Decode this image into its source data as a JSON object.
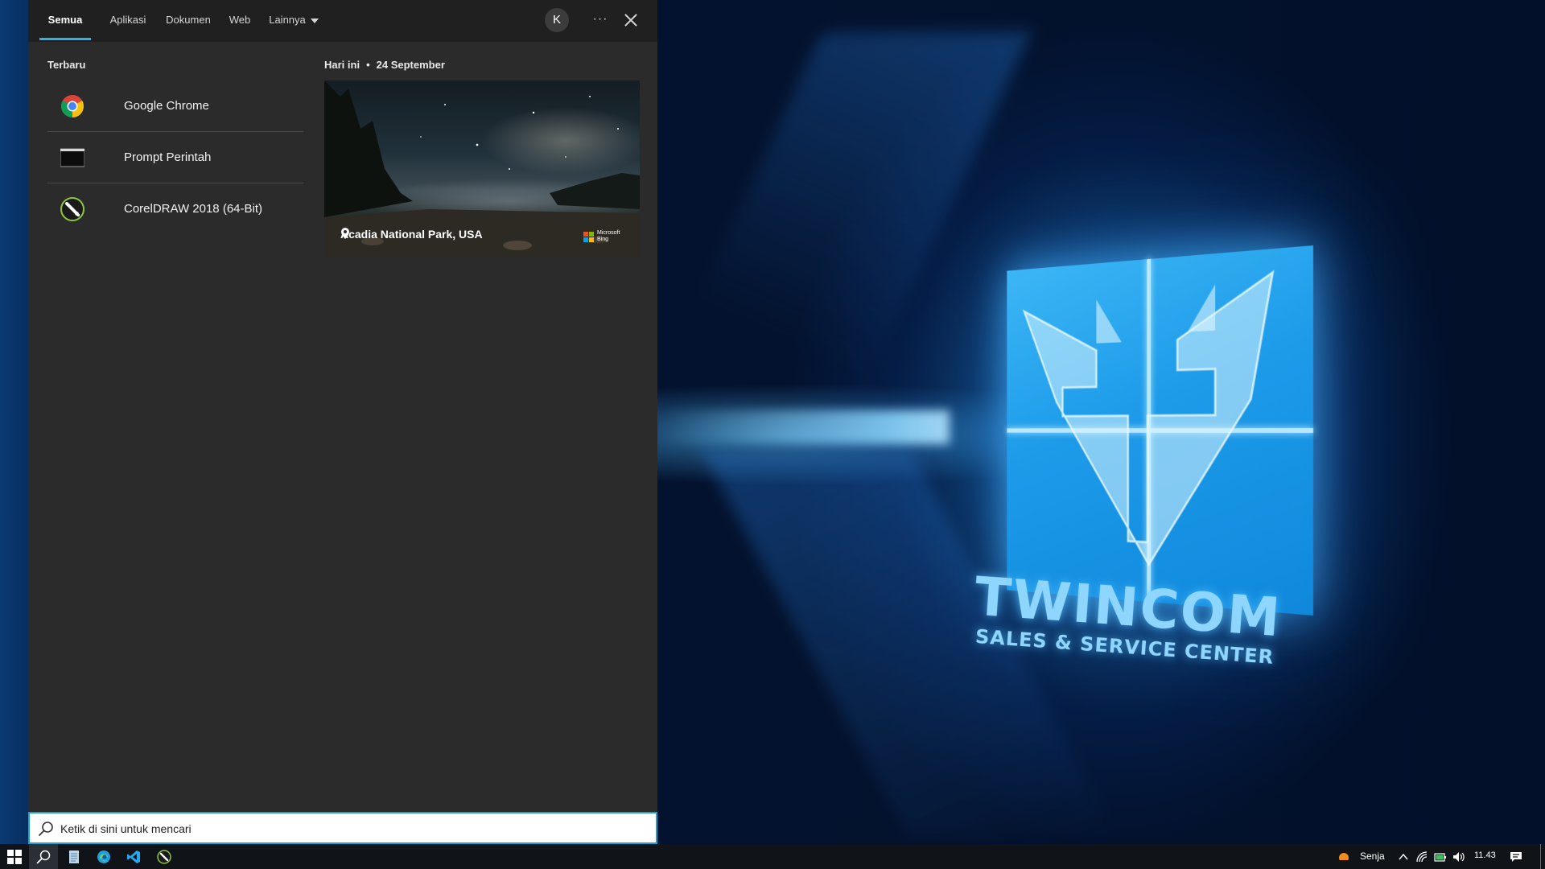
{
  "search": {
    "tabs": [
      {
        "label": "Semua"
      },
      {
        "label": "Aplikasi"
      },
      {
        "label": "Dokumen"
      },
      {
        "label": "Web"
      },
      {
        "label": "Lainnya"
      }
    ],
    "avatar_letter": "K",
    "more_label": "···",
    "recent": {
      "title": "Terbaru",
      "items": [
        {
          "label": "Google Chrome",
          "icon": "chrome-icon"
        },
        {
          "label": "Prompt Perintah",
          "icon": "command-prompt-icon"
        },
        {
          "label": "CorelDRAW 2018 (64-Bit)",
          "icon": "coreldraw-icon"
        }
      ]
    },
    "today": {
      "label": "Hari ini",
      "separator": "•",
      "date": "24 September",
      "location": "Acadia National Park, USA",
      "bing_line1": "Microsoft",
      "bing_line2": "Bing"
    },
    "box": {
      "placeholder": "Ketik di sini untuk mencari"
    }
  },
  "desktop": {
    "brand_name": "TWINCOM",
    "brand_tagline": "SALES & SERVICE CENTER"
  },
  "taskbar": {
    "pinned": [
      "windows-start-icon",
      "search-icon",
      "notepad-icon",
      "edge-icon",
      "vscode-icon",
      "coreldraw-icon"
    ],
    "weather_label": "Senja",
    "clock": "11.43"
  },
  "colors": {
    "accent": "#2fb3e6",
    "panel_bg": "#2b2b2b",
    "tabbar_bg": "#202020",
    "taskbar_bg": "#101419"
  }
}
